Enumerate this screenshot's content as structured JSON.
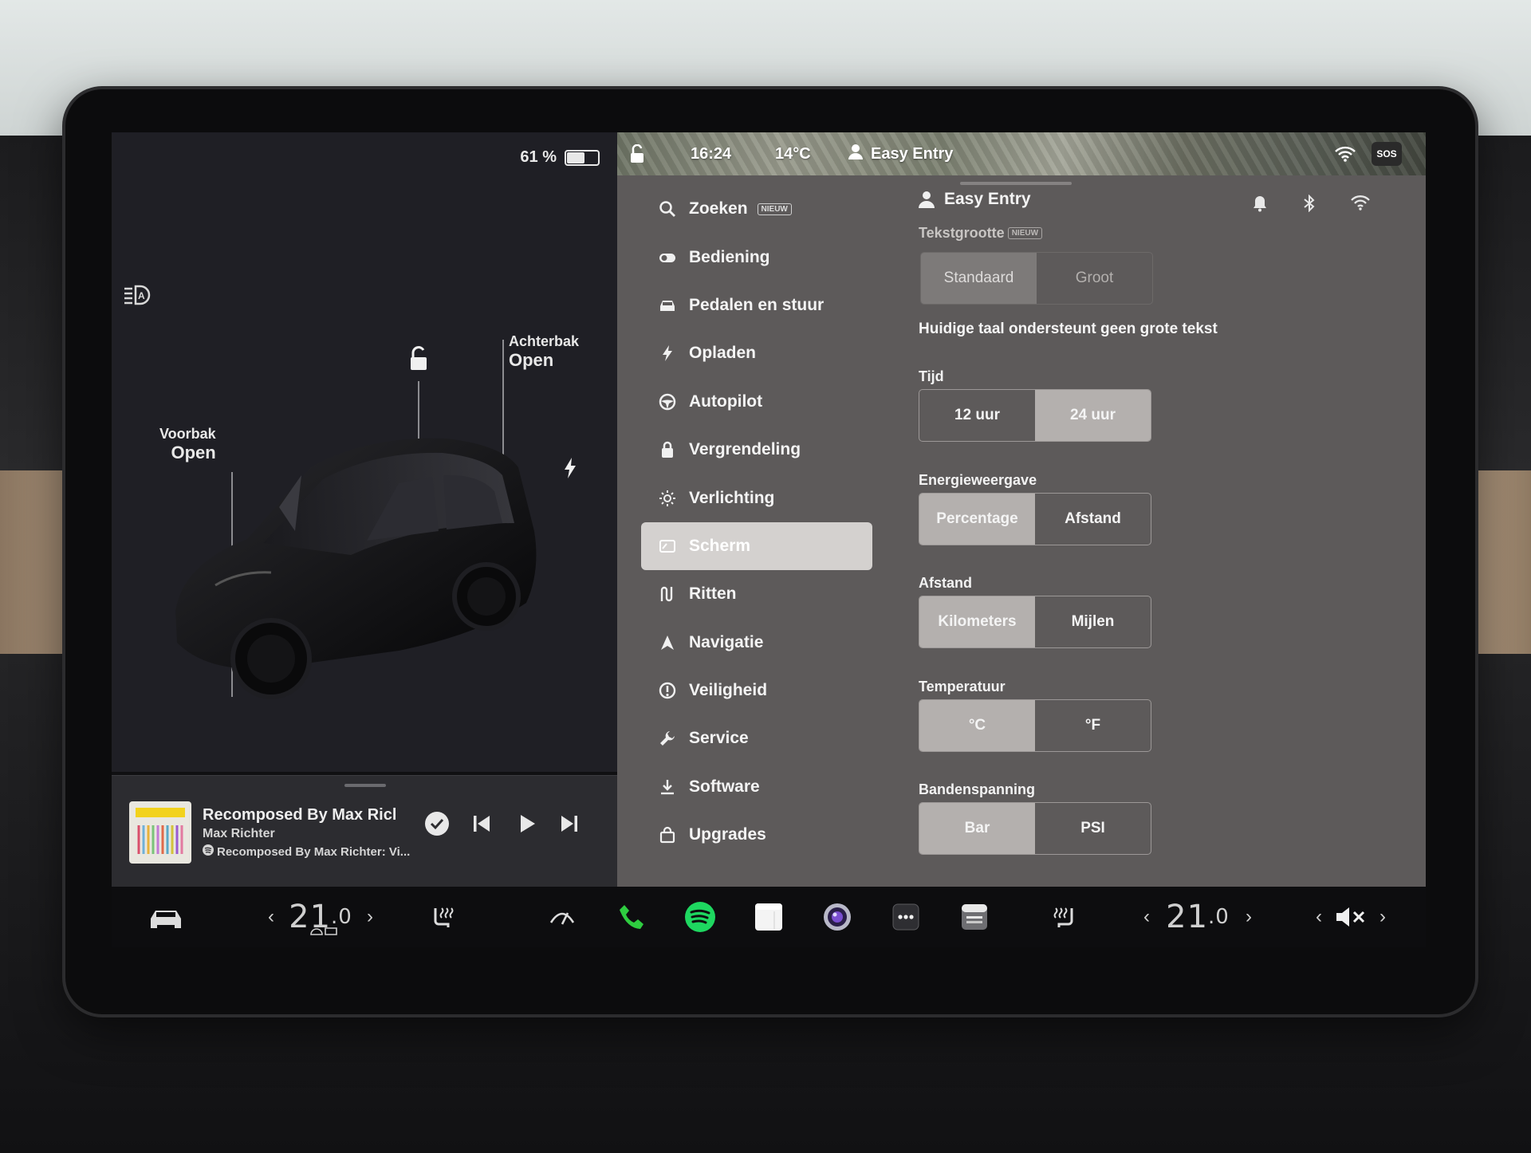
{
  "battery": {
    "percent_text": "61 %",
    "level": 0.61
  },
  "left_pane": {
    "frunk": {
      "title": "Voorbak",
      "state": "Open"
    },
    "trunk": {
      "title": "Achterbak",
      "state": "Open"
    }
  },
  "media": {
    "title": "Recomposed By Max Ricl",
    "artist": "Max Richter",
    "source": "Recomposed By Max Richter: Vi..."
  },
  "status_bar": {
    "time": "16:24",
    "temperature": "14°C",
    "profile": "Easy Entry",
    "sos": "SOS"
  },
  "menu": {
    "items": [
      {
        "label": "Zoeken",
        "icon": "search-icon",
        "badge": "NIEUW"
      },
      {
        "label": "Bediening",
        "icon": "toggle-icon"
      },
      {
        "label": "Pedalen en stuur",
        "icon": "car-front-icon"
      },
      {
        "label": "Opladen",
        "icon": "bolt-icon"
      },
      {
        "label": "Autopilot",
        "icon": "steering-wheel-icon"
      },
      {
        "label": "Vergrendeling",
        "icon": "lock-icon"
      },
      {
        "label": "Verlichting",
        "icon": "sun-icon"
      },
      {
        "label": "Scherm",
        "icon": "display-icon",
        "active": true
      },
      {
        "label": "Ritten",
        "icon": "trips-icon"
      },
      {
        "label": "Navigatie",
        "icon": "navigation-icon"
      },
      {
        "label": "Veiligheid",
        "icon": "safety-icon"
      },
      {
        "label": "Service",
        "icon": "wrench-icon"
      },
      {
        "label": "Software",
        "icon": "download-icon"
      },
      {
        "label": "Upgrades",
        "icon": "shopping-bag-icon"
      }
    ]
  },
  "settings": {
    "profile_name": "Easy Entry",
    "text_size": {
      "label": "Tekstgrootte",
      "badge": "NIEUW",
      "options": [
        "Standaard",
        "Groot"
      ],
      "selected": "Standaard"
    },
    "language_note": "Huidige taal ondersteunt geen grote tekst",
    "time": {
      "label": "Tijd",
      "options": [
        "12 uur",
        "24 uur"
      ],
      "selected": "24 uur"
    },
    "energy": {
      "label": "Energieweergave",
      "options": [
        "Percentage",
        "Afstand"
      ],
      "selected": "Percentage"
    },
    "distance": {
      "label": "Afstand",
      "options": [
        "Kilometers",
        "Mijlen"
      ],
      "selected": "Kilometers"
    },
    "temperature": {
      "label": "Temperatuur",
      "options": [
        "°C",
        "°F"
      ],
      "selected": "°C"
    },
    "tire_pressure": {
      "label": "Bandenspanning",
      "options": [
        "Bar",
        "PSI"
      ],
      "selected": "Bar"
    }
  },
  "bottom_bar": {
    "driver_temp": {
      "whole": "21",
      "decimal": ".0"
    },
    "passenger_temp": {
      "whole": "21",
      "decimal": ".0"
    },
    "apps": [
      "car-icon",
      "seat-heater-icon",
      "wiper-icon",
      "phone-icon",
      "spotify-icon",
      "notes-icon",
      "camera-icon",
      "more-apps-icon",
      "toybox-icon",
      "seat-heater-icon",
      "volume-mute-icon"
    ]
  },
  "colors": {
    "accent_green": "#1ed760",
    "phone_green": "#2ecc40",
    "panel_grey": "#5d5a5a",
    "left_bg": "#1f1f25"
  }
}
